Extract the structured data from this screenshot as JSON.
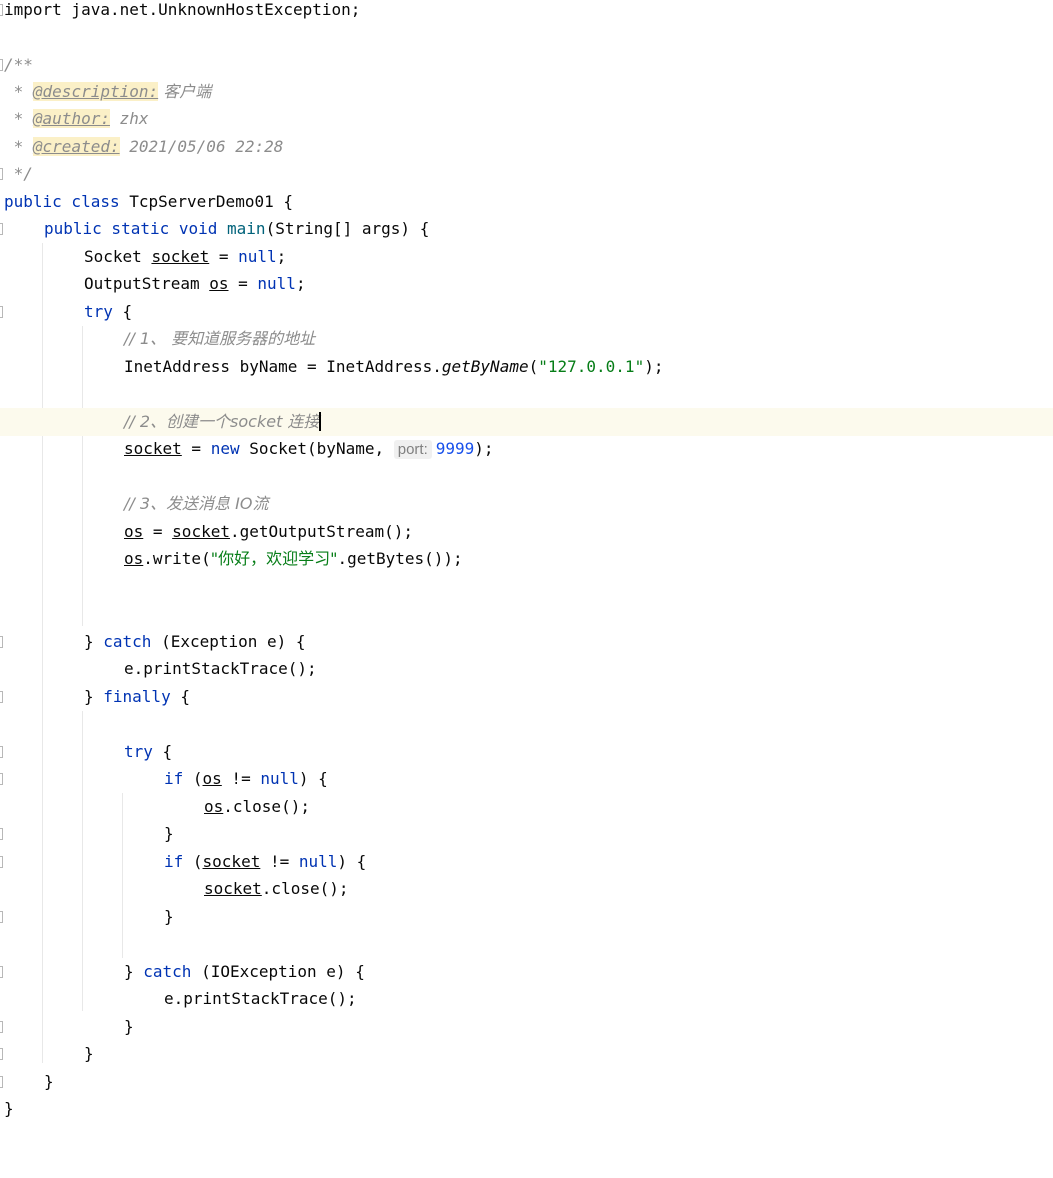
{
  "editor": {
    "import_line": "import java.net.UnknownHostException;",
    "doc": {
      "open": "/**",
      "star": " * ",
      "description_tag": "@description:",
      "description_value": " 客户端",
      "author_tag": "@author:",
      "author_value": " zhx",
      "created_tag": "@created:",
      "created_value": " 2021/05/06 22:28",
      "close": " */"
    },
    "class_decl": {
      "kw": "public class",
      "name": " TcpServerDemo01 {"
    },
    "main_decl": {
      "kw": "public static void",
      "method": " main",
      "rest": "(String[] args) {"
    },
    "socket_decl": {
      "type": "Socket ",
      "var": "socket",
      "eq": " = ",
      "null": "null",
      "end": ";"
    },
    "os_decl": {
      "type": "OutputStream ",
      "var": "os",
      "eq": " = ",
      "null": "null",
      "end": ";"
    },
    "try_kw": "try",
    "brace_open": " {",
    "comment1": "// 1、 要知道服务器的地址",
    "inet_line": {
      "start": "InetAddress byName = InetAddress.",
      "method": "getByName",
      "paren": "(",
      "str": "\"127.0.0.1\"",
      "end": ");"
    },
    "comment2": "// 2、创建一个socket 连接",
    "socket_assign": {
      "var": "socket",
      "eq": " = ",
      "new": "new",
      "rest": " Socket(byName, ",
      "hint": "port:",
      "port": "9999",
      "end": ");"
    },
    "comment3": "// 3、发送消息 IO流",
    "os_assign": {
      "var": "os",
      "eq": " = ",
      "var2": "socket",
      "rest": ".getOutputStream();"
    },
    "os_write": {
      "var": "os",
      "start": ".write(",
      "str": "\"你好，欢迎学习\"",
      "end": ".getBytes());"
    },
    "catch_line": {
      "brace": "} ",
      "kw": "catch",
      "rest": " (Exception e) {"
    },
    "print_stack": "e.printStackTrace();",
    "finally_line": {
      "brace": "} ",
      "kw": "finally",
      "rest": " {"
    },
    "if_os": {
      "kw": "if",
      "open": " (",
      "var": "os",
      "op": " != ",
      "null": "null",
      "end": ") {"
    },
    "os_close": {
      "var": "os",
      "rest": ".close();"
    },
    "if_socket": {
      "kw": "if",
      "open": " (",
      "var": "socket",
      "op": " != ",
      "null": "null",
      "end": ") {"
    },
    "socket_close": {
      "var": "socket",
      "rest": ".close();"
    },
    "io_catch": {
      "brace": "} ",
      "kw": "catch",
      "rest": " (IOException e) {"
    },
    "close_brace": "}"
  },
  "colors": {
    "keyword": "#0033b3",
    "string": "#067d17",
    "number": "#1750eb",
    "comment": "#8c8c8c",
    "method": "#00627a",
    "doctag_bg": "#fbf0c7",
    "current_line_bg": "#fcfaed"
  }
}
